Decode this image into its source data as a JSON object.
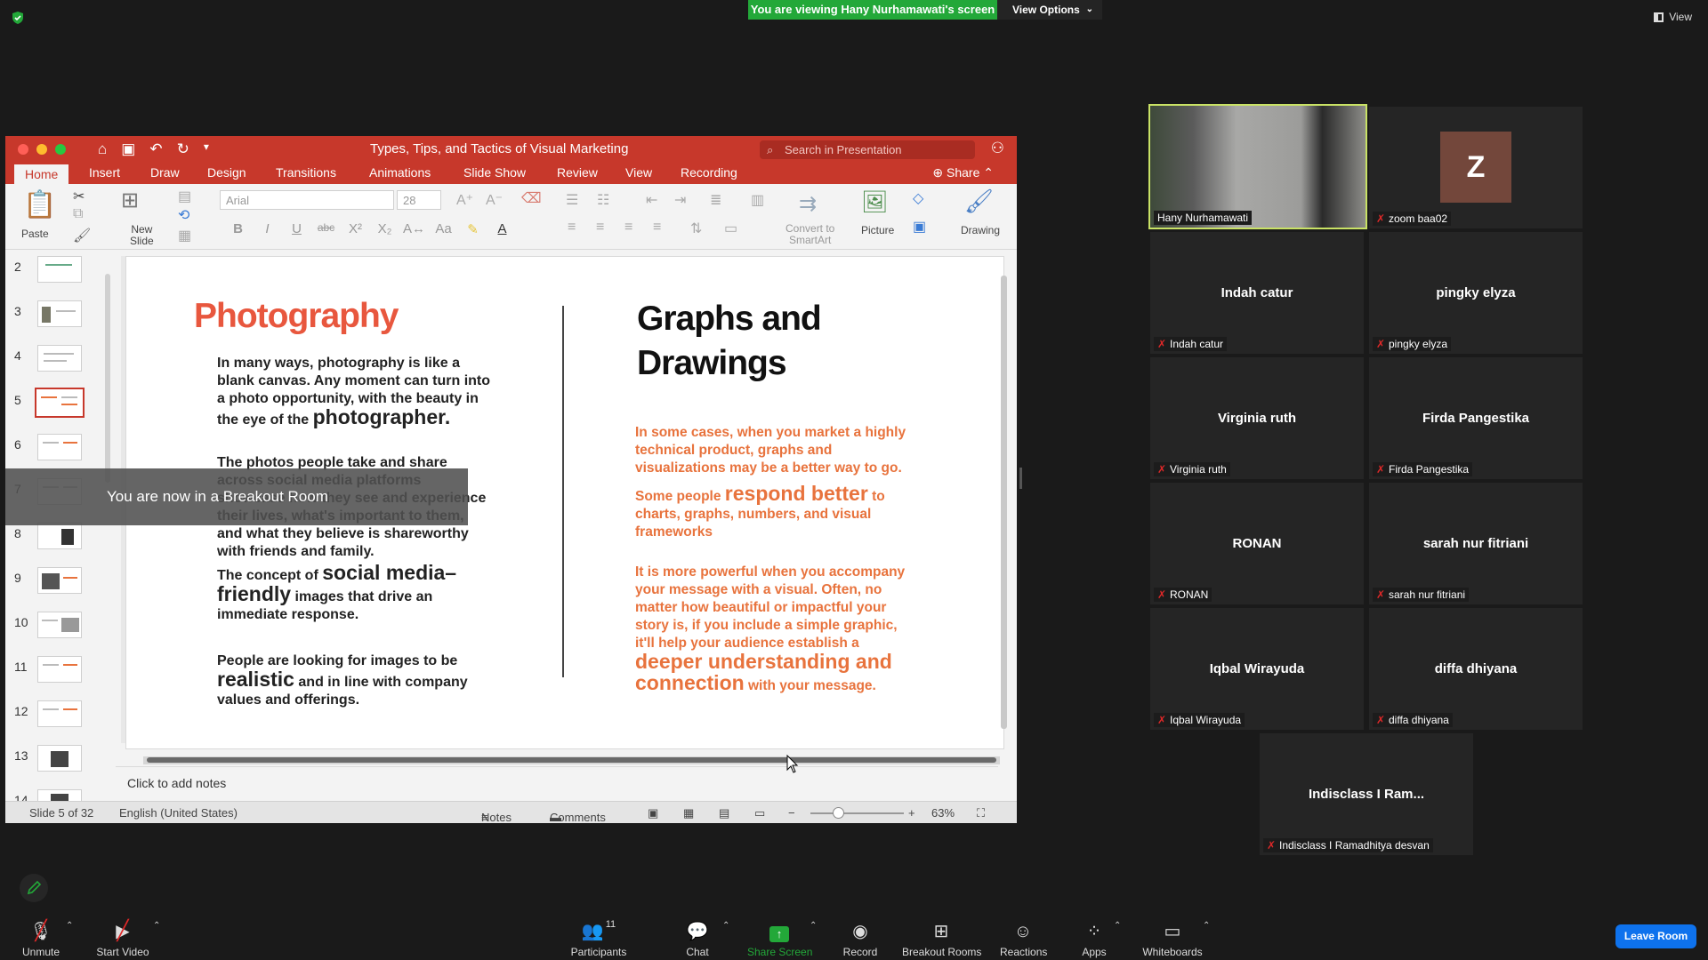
{
  "zoom": {
    "banner": "You are viewing Hany Nurhamawati's screen",
    "view_options": "View Options",
    "view_label": "View",
    "breakout_toast": "You are now in a Breakout Room",
    "leave_label": "Leave Room",
    "toolbar": [
      {
        "label": "Unmute",
        "icon": "mic-muted-icon"
      },
      {
        "label": "Start Video",
        "icon": "video-off-icon"
      },
      {
        "label": "Participants",
        "icon": "participants-icon",
        "badge": "11"
      },
      {
        "label": "Chat",
        "icon": "chat-icon"
      },
      {
        "label": "Share Screen",
        "icon": "share-screen-icon"
      },
      {
        "label": "Record",
        "icon": "record-icon"
      },
      {
        "label": "Breakout Rooms",
        "icon": "breakout-rooms-icon"
      },
      {
        "label": "Reactions",
        "icon": "reactions-icon"
      },
      {
        "label": "Apps",
        "icon": "apps-icon"
      },
      {
        "label": "Whiteboards",
        "icon": "whiteboards-icon"
      }
    ],
    "participants": [
      {
        "display": "",
        "label": "Hany Nurhamawati"
      },
      {
        "display": "Z",
        "label": "zoom baa02"
      },
      {
        "display": "Indah catur",
        "label": "Indah catur"
      },
      {
        "display": "pingky elyza",
        "label": "pingky elyza"
      },
      {
        "display": "Virginia ruth",
        "label": "Virginia ruth"
      },
      {
        "display": "Firda Pangestika",
        "label": "Firda Pangestika"
      },
      {
        "display": "RONAN",
        "label": "RONAN"
      },
      {
        "display": "sarah nur fitriani",
        "label": "sarah nur fitriani"
      },
      {
        "display": "Iqbal Wirayuda",
        "label": "Iqbal Wirayuda"
      },
      {
        "display": "diffa dhiyana",
        "label": "diffa dhiyana"
      },
      {
        "display": "Indisclass I Ram...",
        "label": "Indisclass I Ramadhitya desvan"
      }
    ],
    "colors": {
      "banner": "#23a839",
      "leave": "#0e72ed",
      "active_speaker": "#c9e265"
    }
  },
  "ppt": {
    "title": "Types, Tips, and Tactics of Visual Marketing",
    "search_placeholder": "Search in Presentation",
    "tabs": [
      "Home",
      "Insert",
      "Draw",
      "Design",
      "Transitions",
      "Animations",
      "Slide Show",
      "Review",
      "View",
      "Recording"
    ],
    "share": "Share",
    "font_name": "Arial",
    "font_size": "28",
    "ribbon_labels": {
      "paste": "Paste",
      "new_slide": "New\nSlide",
      "convert": "Convert to\nSmartArt",
      "picture": "Picture",
      "drawing": "Drawing"
    },
    "thumb_numbers": [
      "2",
      "3",
      "4",
      "5",
      "6",
      "7",
      "8",
      "9",
      "10",
      "11",
      "12",
      "13",
      "14"
    ],
    "selected_slide": "5",
    "notes_placeholder": "Click to add notes",
    "status": {
      "slide": "Slide 5 of 32",
      "language": "English (United States)",
      "notes": "Notes",
      "comments": "Comments",
      "zoom": "63%"
    },
    "slide": {
      "left_heading": "Photography",
      "p1a": "In many ways, photography is like a blank canvas. Any moment can turn into a photo opportunity, with the beauty in the eye of the",
      "p1b": "photographer.",
      "p2": "The photos people take and share across social media platforms showcase how they see and experience their lives, what's important to them, and what they believe is shareworthy with friends and family.",
      "p3a": "The concept of",
      "p3b": "social media–friendly",
      "p3c": "images that drive an immediate response.",
      "p4a": "People are looking for images to be",
      "p4b": "realistic",
      "p4c": "and in line with company values and offerings.",
      "right_heading_1": "Graphs and",
      "right_heading_2": "Drawings",
      "o1": "In some cases, when you market a highly technical product, graphs and visualizations may be a better way to go.",
      "o2a": "Some people",
      "o2b": "respond better",
      "o2c": "to charts, graphs, numbers, and visual frameworks",
      "o3a": "It is more powerful when you accompany your message with a visual. Often, no matter how beautiful or impactful your story is, if you include a simple graphic, it'll help your audience establish a",
      "o3b": "deeper understanding and connection",
      "o3c": "with your message."
    },
    "colors": {
      "accent": "#c7382b",
      "heading_orange": "#e8573e",
      "text_orange": "#e8733d"
    }
  }
}
